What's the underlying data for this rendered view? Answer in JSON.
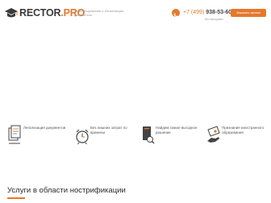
{
  "header": {
    "logo_left": "RECTOR",
    "logo_dot": ".",
    "logo_right": "PRO",
    "tagline": "Апостилирование и Легализация документов",
    "phone_prefix": "+7 (499)",
    "phone_number": "938-53-60",
    "phone_note": "Без выходных",
    "callback_label": "Заказать звонок"
  },
  "features": [
    {
      "icon": "documents-legalization-icon",
      "text": "Легализация документов"
    },
    {
      "icon": "alarm-clock-icon",
      "text": "Без лишних затрат по времени"
    },
    {
      "icon": "book-search-icon",
      "text": "Найдем самое выгодное решение"
    },
    {
      "icon": "diploma-hand-icon",
      "text": "Признание иностранного образования"
    }
  ],
  "section": {
    "title": "Услуги в области нострификации"
  },
  "colors": {
    "accent": "#e5782c",
    "text_dark": "#333333",
    "text_muted": "#9a9a9a"
  }
}
